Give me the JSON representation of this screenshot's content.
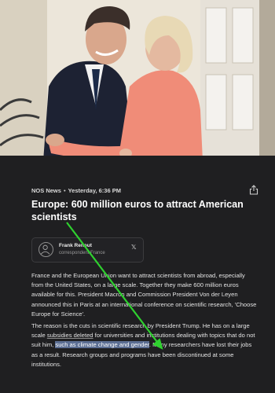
{
  "article": {
    "source": "NOS News",
    "separator": "•",
    "timestamp": "Yesterday, 6:36 PM",
    "headline": "Europe: 600 million euros to attract American scientists",
    "author": {
      "name": "Frank Renout",
      "role": "correspondent France"
    },
    "paragraph1": "France and the European Union want to attract scientists from abroad, especially from the United States, on a large scale. Together they make 600 million euros available for this. President Macron and Commission President Von der Leyen announced this in Paris at an international conference on scientific research, 'Choose Europe for Science'.",
    "paragraph2": {
      "part1": "The reason is the cuts in scientific research by President Trump. He has on a large scale ",
      "link": "subsidies deleted",
      "part2": " for universities and institutions dealing with topics that do not suit him, ",
      "highlight": "such as climate change and gender",
      "part3": ". Many researchers have lost their jobs as a result. Research groups and programs have been discontinued at some institutions."
    }
  },
  "icons": {
    "share": "share-icon",
    "x": "x-social-icon",
    "avatar": "person-avatar-icon"
  },
  "colors": {
    "background": "#1f1f21",
    "highlight": "#5b6e93",
    "annotation_arrow": "#2fd12f"
  }
}
